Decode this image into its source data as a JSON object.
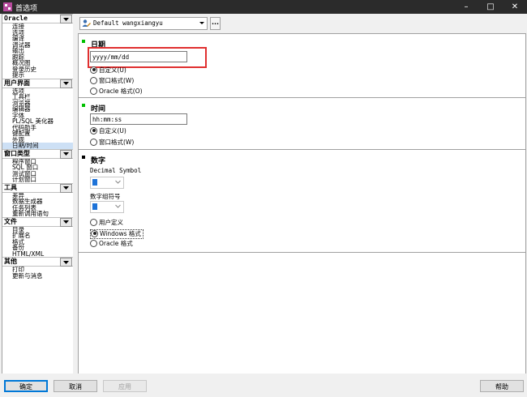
{
  "window": {
    "title": "首选项",
    "minimize": "–",
    "maximize": "□",
    "close": "✕"
  },
  "sidebar": {
    "groups": [
      {
        "title": "Oracle",
        "items": [
          "连接",
          "选项",
          "编译",
          "调试器",
          "输出",
          "跟踪",
          "概况图",
          "登录历史",
          "提示"
        ]
      },
      {
        "title": "用户界面",
        "items": [
          "选项",
          "工具栏",
          "浏览器",
          "编辑器",
          "字体",
          "PL/SQL 美化器",
          "代码助手",
          "键配置",
          "外观",
          "日期/时间"
        ],
        "selected": "日期/时间"
      },
      {
        "title": "窗口类型",
        "items": [
          "程序窗口",
          "SQL 窗口",
          "测试窗口",
          "计划窗口"
        ]
      },
      {
        "title": "工具",
        "items": [
          "差异",
          "数据生成器",
          "任务列表",
          "重新调用语句"
        ]
      },
      {
        "title": "文件",
        "items": [
          "目录",
          "扩展名",
          "格式",
          "备份",
          "HTML/XML"
        ]
      },
      {
        "title": "其他",
        "items": [
          "打印",
          "更新与消息"
        ]
      }
    ]
  },
  "toolbar": {
    "profile": "Default wangxiangyu",
    "ellipsis": "..."
  },
  "date_section": {
    "title": "日期",
    "format_value": "yyyy/mm/dd",
    "options": [
      "自定义(U)",
      "窗口格式(W)",
      "Oracle 格式(O)"
    ],
    "selected_index": 0
  },
  "time_section": {
    "title": "时间",
    "format_value": "hh:mm:ss",
    "options": [
      "自定义(U)",
      "窗口格式(W)"
    ],
    "selected_index": 0
  },
  "number_section": {
    "title": "数字",
    "decimal_label": "Decimal Symbol",
    "group_label": "数字组符号",
    "options": [
      "用户定义",
      "Windows 格式",
      "Oracle 格式"
    ],
    "selected_index": 1
  },
  "buttons": {
    "ok": "确定",
    "cancel": "取消",
    "apply": "应用",
    "help": "帮助"
  },
  "colors": {
    "marker_active": "#00c000",
    "marker_inactive": "#000000",
    "highlight": "#e03030",
    "selected_item": "#cde0f5",
    "swatch": "#1e73d8"
  }
}
